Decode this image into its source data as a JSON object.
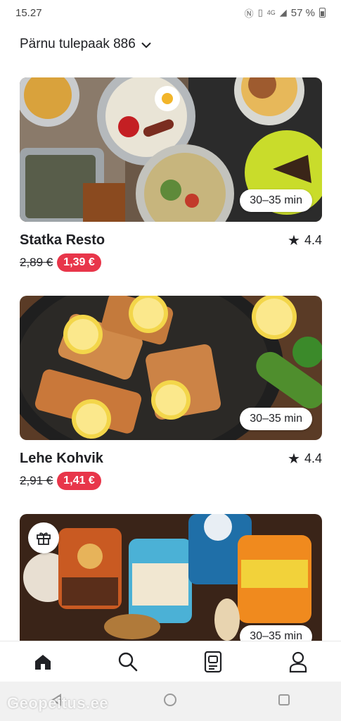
{
  "status_bar": {
    "time": "15.27",
    "network": "4G",
    "battery": "57 %"
  },
  "header": {
    "location": "Pärnu tulepaak 886"
  },
  "restaurants": [
    {
      "name": "Statka Resto",
      "rating": "4.4",
      "delivery_time": "30–35 min",
      "old_price": "2,89 €",
      "new_price": "1,39 €"
    },
    {
      "name": "Lehe Kohvik",
      "rating": "4.4",
      "delivery_time": "30–35 min",
      "old_price": "2,91 €",
      "new_price": "1,41 €"
    },
    {
      "delivery_time": "30–35 min"
    }
  ],
  "bottom_nav": [
    {
      "icon": "home-icon"
    },
    {
      "icon": "search-icon"
    },
    {
      "icon": "orders-icon"
    },
    {
      "icon": "profile-icon"
    }
  ],
  "watermark": "Geopeitus.ee",
  "colors": {
    "accent_red": "#e8364a",
    "text": "#202125"
  }
}
